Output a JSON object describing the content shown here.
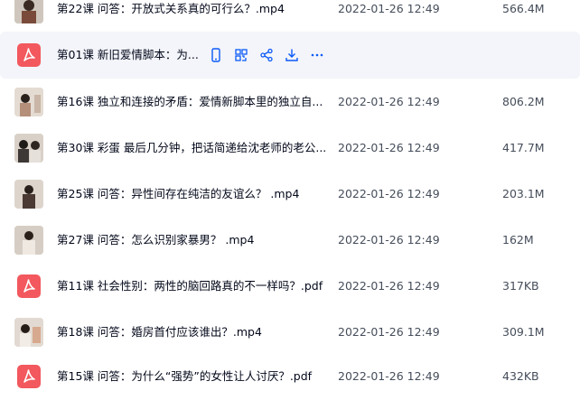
{
  "colors": {
    "pdf_red": "#f2585d",
    "action_blue": "#0a59f7",
    "hover_bg": "#f3f5fa"
  },
  "files": [
    {
      "name": "第22课 问答：开放式关系真的可行么？.mp4",
      "date": "2022-01-26 12:49",
      "size": "566.4M",
      "kind": "video"
    },
    {
      "name": "第01课 新旧爱情脚本：为...",
      "date": "",
      "size": "",
      "kind": "pdf"
    },
    {
      "name": "第16课 独立和连接的矛盾：爱情新脚本里的独立自...",
      "date": "2022-01-26 12:49",
      "size": "806.2M",
      "kind": "video"
    },
    {
      "name": "第30课 彩蛋 最后几分钟，把话简递给沈老师的老公...",
      "date": "2022-01-26 12:49",
      "size": "417.7M",
      "kind": "video"
    },
    {
      "name": "第25课 问答：异性间存在纯洁的友谊么？ .mp4",
      "date": "2022-01-26 12:49",
      "size": "203.1M",
      "kind": "video"
    },
    {
      "name": "第27课 问答：怎么识别家暴男？ .mp4",
      "date": "2022-01-26 12:49",
      "size": "162M",
      "kind": "video"
    },
    {
      "name": "第11课 社会性别：两性的脑回路真的不一样吗？.pdf",
      "date": "2022-01-26 12:49",
      "size": "317KB",
      "kind": "pdf"
    },
    {
      "name": "第18课 问答：婚房首付应该谁出？.mp4",
      "date": "2022-01-26 12:49",
      "size": "309.1M",
      "kind": "video"
    },
    {
      "name": "第15课 问答：为什么“强势”的女性让人讨厌？.pdf",
      "date": "2022-01-26 12:49",
      "size": "432KB",
      "kind": "pdf"
    }
  ],
  "hover_actions": [
    "phone-icon",
    "scan-qr-icon",
    "share-icon",
    "download-icon",
    "more-icon"
  ]
}
